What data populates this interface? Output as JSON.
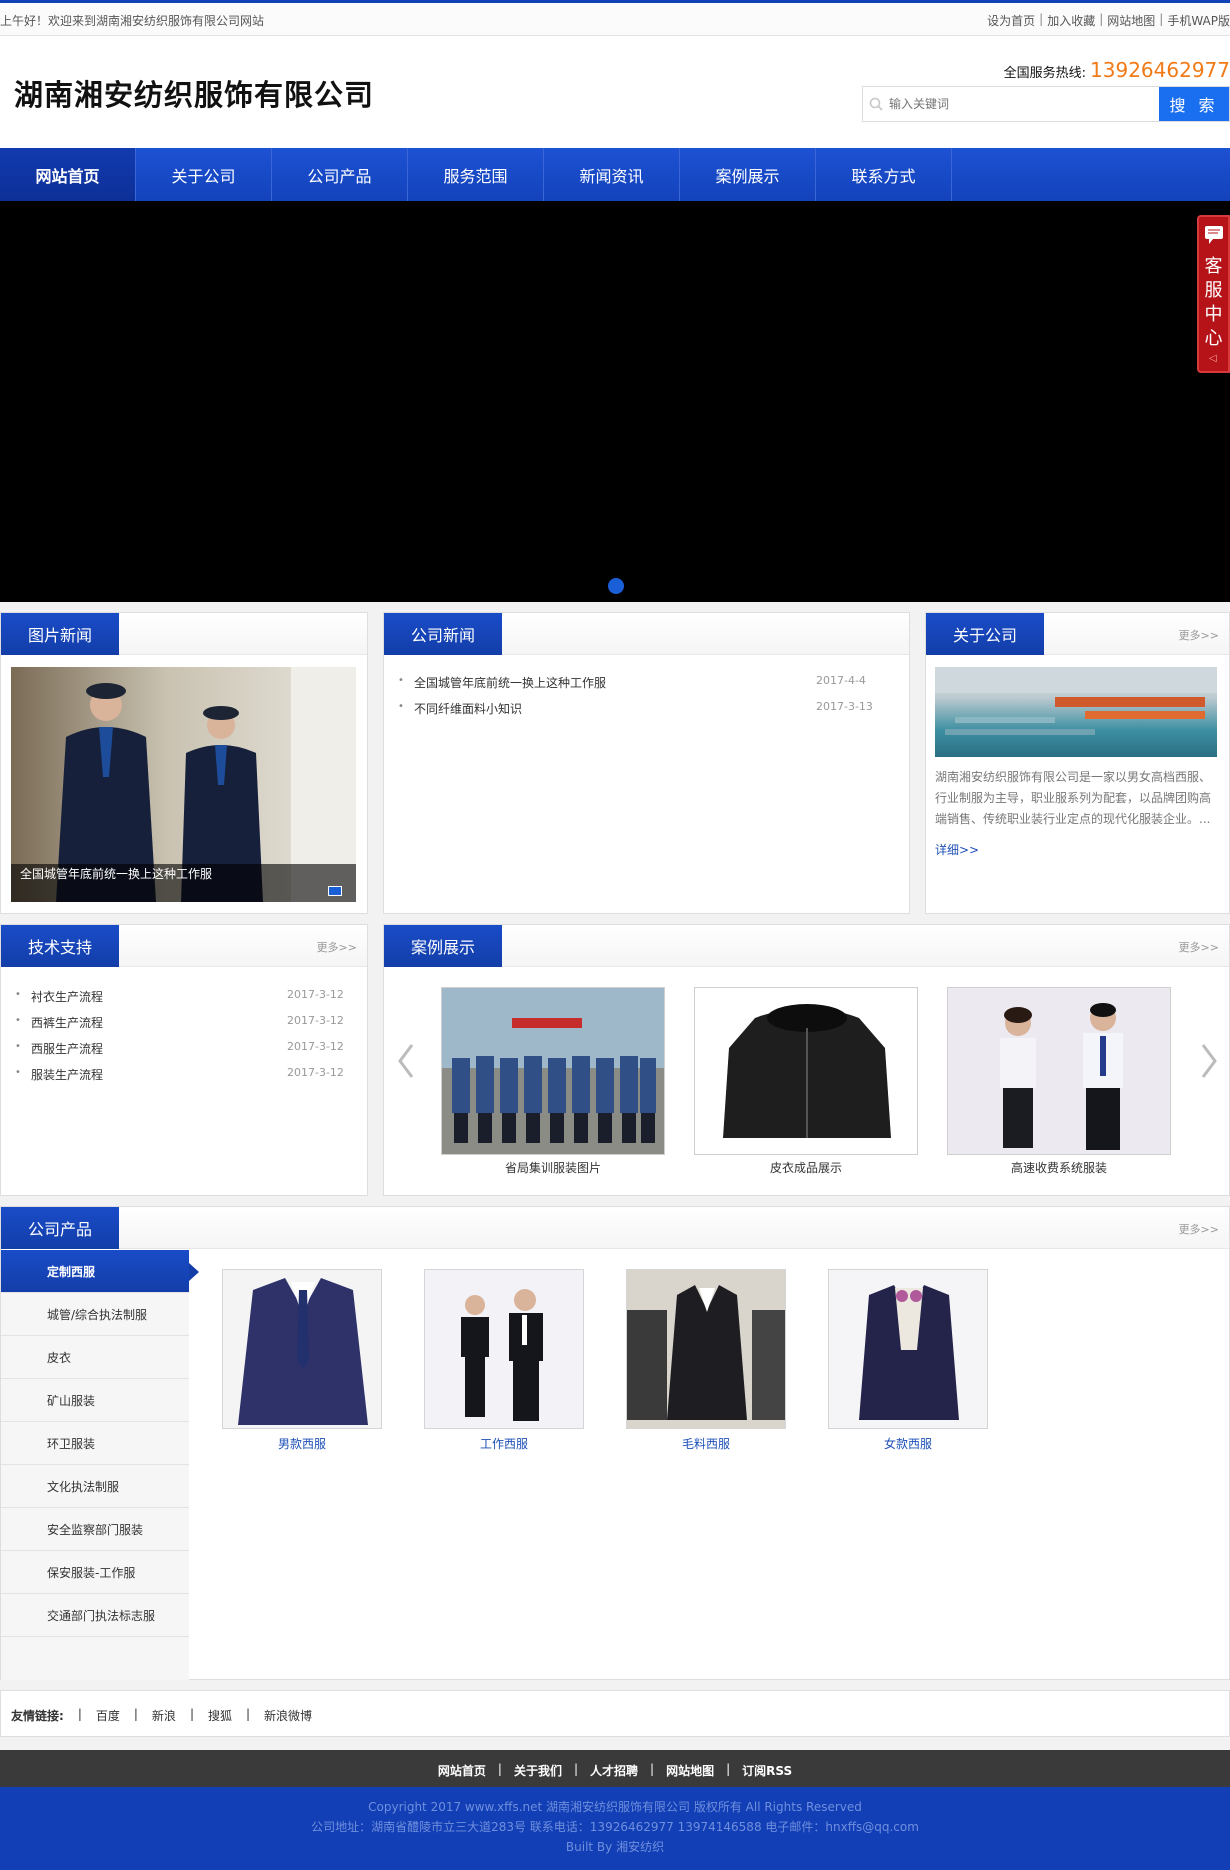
{
  "topbar": {
    "welcome": "上午好！欢迎来到湖南湘安纺织服饰有限公司网站",
    "links": [
      "设为首页",
      "加入收藏",
      "网站地图",
      "手机WAP版"
    ]
  },
  "header": {
    "logo": "湖南湘安纺织服饰有限公司",
    "hotline_label": "全国服务热线:",
    "hotline_number": "13926462977",
    "search_placeholder": "输入关键词",
    "search_button": "搜 索"
  },
  "nav": [
    "网站首页",
    "关于公司",
    "公司产品",
    "服务范围",
    "新闻资讯",
    "案例展示",
    "联系方式"
  ],
  "service": {
    "label": "客服中心",
    "chars": [
      "客",
      "服",
      "中",
      "心"
    ]
  },
  "pic_news": {
    "title": "图片新闻",
    "caption": "全国城管年底前统一换上这种工作服"
  },
  "company_news": {
    "title": "公司新闻",
    "items": [
      {
        "title": "全国城管年底前统一换上这种工作服",
        "date": "2017-4-4"
      },
      {
        "title": "不同纤维面料小知识",
        "date": "2017-3-13"
      }
    ]
  },
  "about": {
    "title": "关于公司",
    "more": "更多>>",
    "text": "湖南湘安纺织服饰有限公司是一家以男女高档西服、行业制服为主导，职业服系列为配套，以品牌团购高端销售、传统职业装行业定点的现代化服装企业。...",
    "detail": "详细>>"
  },
  "tech": {
    "title": "技术支持",
    "more": "更多>>",
    "items": [
      {
        "title": "衬衣生产流程",
        "date": "2017-3-12"
      },
      {
        "title": "西裤生产流程",
        "date": "2017-3-12"
      },
      {
        "title": "西服生产流程",
        "date": "2017-3-12"
      },
      {
        "title": "服装生产流程",
        "date": "2017-3-12"
      }
    ]
  },
  "cases": {
    "title": "案例展示",
    "more": "更多>>",
    "items": [
      "省局集训服装图片",
      "皮衣成品展示",
      "高速收费系统服装"
    ]
  },
  "products": {
    "title": "公司产品",
    "more": "更多>>",
    "categories": [
      "定制西服",
      "城管/综合执法制服",
      "皮衣",
      "矿山服装",
      "环卫服装",
      "文化执法制服",
      "安全监察部门服装",
      "保安服装-工作服",
      "交通部门执法标志服"
    ],
    "items": [
      "男款西服",
      "工作西服",
      "毛料西服",
      "女款西服"
    ]
  },
  "friend_links": {
    "label": "友情链接:",
    "items": [
      "百度",
      "新浪",
      "搜狐",
      "新浪微博"
    ]
  },
  "footer_nav": [
    "网站首页",
    "关于我们",
    "人才招聘",
    "网站地图",
    "订阅RSS"
  ],
  "footer": {
    "line1": "Copyright 2017 www.xffs.net 湖南湘安纺织服饰有限公司 版权所有 All Rights Reserved",
    "line2": "公司地址：湖南省醴陵市立三大道283号 联系电话：13926462977 13974146588 电子邮件：hnxffs@qq.com",
    "line3": "Built By 湘安纺织"
  },
  "colors": {
    "brand_blue": "#1342bb",
    "accent_orange": "#f27a16",
    "service_red": "#b51318"
  }
}
